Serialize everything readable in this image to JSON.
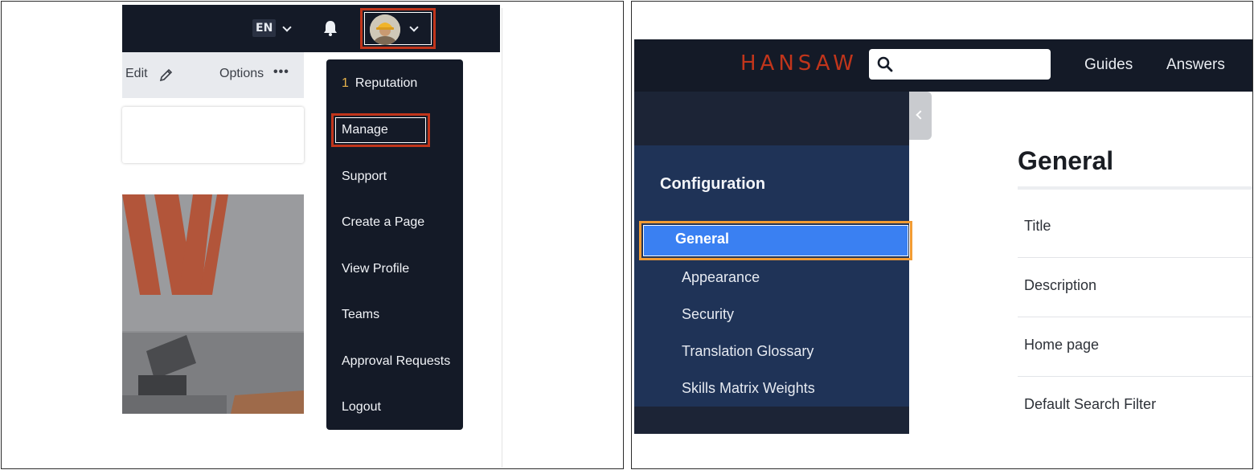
{
  "left": {
    "topbar": {
      "language": "EN",
      "icons": [
        "language-chevron-icon",
        "bell-icon",
        "avatar-chevron-icon"
      ]
    },
    "toolbar": {
      "edit_label": "Edit",
      "options_label": "Options",
      "options_icon": "•••"
    },
    "dropdown": {
      "reputation_count": "1",
      "items": [
        "Reputation",
        "Manage",
        "Support",
        "Create a Page",
        "View Profile",
        "Teams",
        "Approval Requests",
        "Logout"
      ],
      "highlighted": "Manage"
    },
    "colors": {
      "topbar": "#141a27",
      "highlight_border": "#c1351b",
      "reputation_count": "#e9b44c"
    }
  },
  "right": {
    "logo": "HANSAW",
    "search": {
      "placeholder": ""
    },
    "nav": [
      "Guides",
      "Answers"
    ],
    "sidebar": {
      "heading": "Configuration",
      "items": [
        "General",
        "Appearance",
        "Security",
        "Translation Glossary",
        "Skills Matrix Weights"
      ],
      "active": "General"
    },
    "main": {
      "title": "General",
      "fields": [
        "Title",
        "Description",
        "Home page",
        "Default Search Filter"
      ]
    },
    "colors": {
      "logo": "#c1351b",
      "sidebar": "#1f3357",
      "active_item": "#3a80f2",
      "highlight_border": "#f29c33"
    }
  }
}
